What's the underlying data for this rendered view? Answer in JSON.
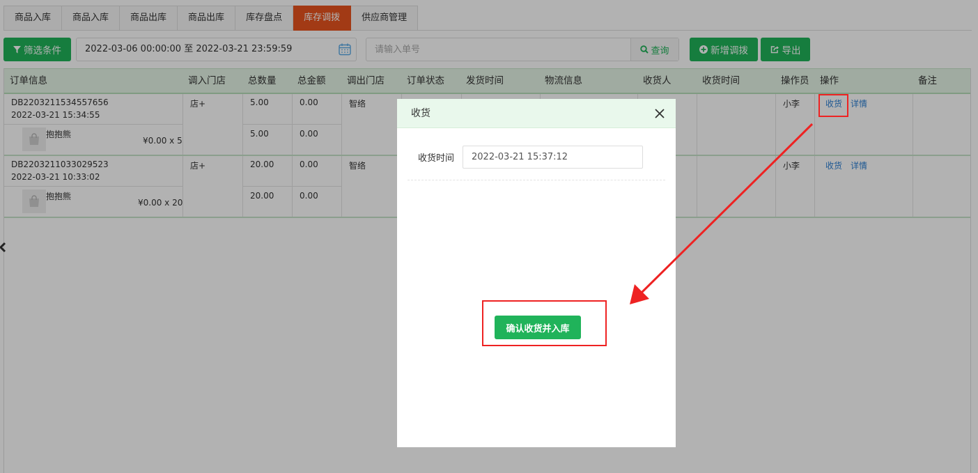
{
  "tabs": [
    {
      "label": "商品入库",
      "active": false
    },
    {
      "label": "商品入库",
      "active": false
    },
    {
      "label": "商品出库",
      "active": false
    },
    {
      "label": "商品出库",
      "active": false
    },
    {
      "label": "库存盘点",
      "active": false
    },
    {
      "label": "库存调拨",
      "active": true
    },
    {
      "label": "供应商管理",
      "active": false
    }
  ],
  "toolbar": {
    "filter_label": "筛选条件",
    "date_range": "2022-03-06 00:00:00 至 2022-03-21 23:59:59",
    "search_placeholder": "请输入单号",
    "query_label": "查询",
    "add_label": "新增调拨",
    "export_label": "导出"
  },
  "table": {
    "headers": {
      "order_info": "订单信息",
      "in_store": "调入门店",
      "total_qty": "总数量",
      "total_amount": "总金额",
      "out_store": "调出门店",
      "status": "订单状态",
      "ship_time": "发货时间",
      "logistics": "物流信息",
      "receiver": "收货人",
      "receive_time": "收货时间",
      "operator": "操作员",
      "actions": "操作",
      "remark": "备注"
    },
    "rows": [
      {
        "order_no": "DB2203211534557656",
        "date": "2022-03-21 15:34:55",
        "in_store": "店+",
        "total_qty": "5.00",
        "total_amount": "0.00",
        "out_store": "智络",
        "operator": "小李",
        "action_receive": "收货",
        "action_detail": "详情",
        "item": {
          "name": "抱抱熊",
          "price_qty": "¥0.00 x 5",
          "qty": "5.00",
          "amount": "0.00"
        }
      },
      {
        "order_no": "DB2203211033029523",
        "date": "2022-03-21 10:33:02",
        "in_store": "店+",
        "total_qty": "20.00",
        "total_amount": "0.00",
        "out_store": "智络",
        "operator": "小李",
        "action_receive": "收货",
        "action_detail": "详情",
        "item": {
          "name": "抱抱熊",
          "price_qty": "¥0.00 x 20",
          "qty": "20.00",
          "amount": "0.00"
        }
      }
    ]
  },
  "modal": {
    "title": "收货",
    "time_label": "收货时间",
    "time_value": "2022-03-21 15:37:12",
    "confirm_label": "确认收货并入库"
  },
  "colors": {
    "accent_green": "#20b35a",
    "active_tab": "#e8541f",
    "link_blue": "#2b7fd3",
    "annotation_red": "#ee2222"
  }
}
